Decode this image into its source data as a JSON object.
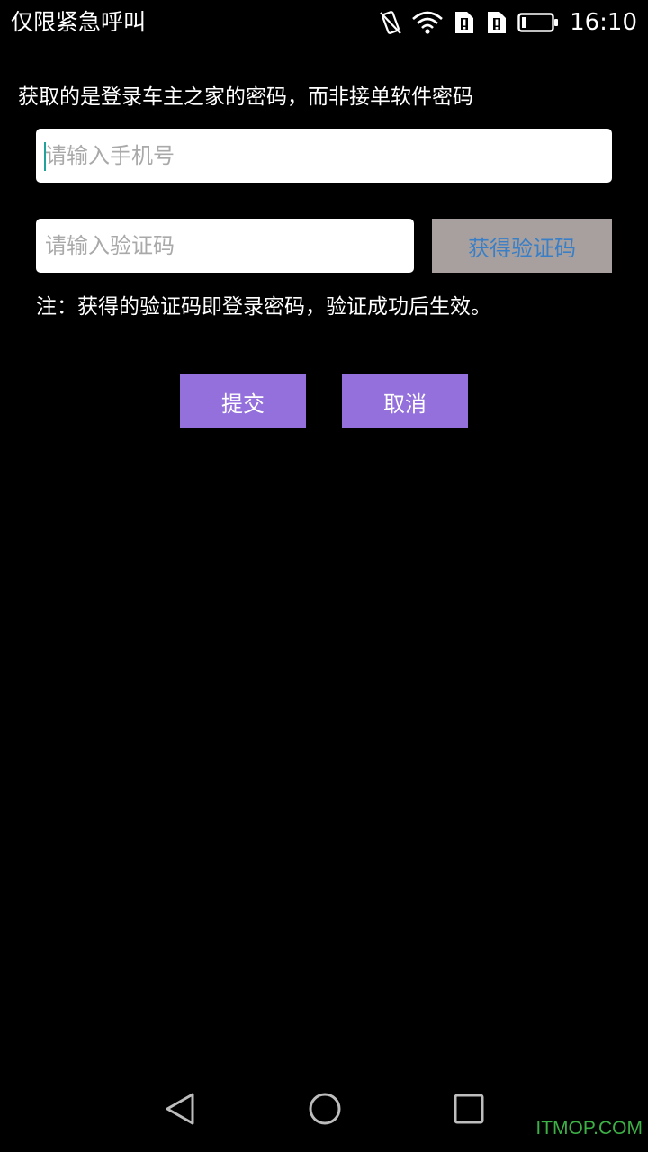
{
  "status_bar": {
    "carrier": "仅限紧急呼叫",
    "time": "16:10",
    "icons": [
      "vibrate-icon",
      "wifi-icon",
      "sim-alert-icon",
      "sim-alert-icon",
      "battery-icon"
    ]
  },
  "form": {
    "hint": "获取的是登录车主之家的密码，而非接单软件密码",
    "phone_placeholder": "请输入手机号",
    "phone_value": "",
    "code_placeholder": "请输入验证码",
    "code_value": "",
    "get_code_label": "获得验证码",
    "note": "注：获得的验证码即登录密码，验证成功后生效。"
  },
  "actions": {
    "submit_label": "提交",
    "cancel_label": "取消"
  },
  "nav_bar": {
    "buttons": [
      "back-icon",
      "home-icon",
      "recent-apps-icon"
    ]
  },
  "watermark": "ITMOP.COM",
  "colors": {
    "background": "#000000",
    "action_button": "#9370db",
    "get_code_button_bg": "#a8a09e",
    "get_code_button_text": "#3a7fc6",
    "watermark": "#3db046"
  }
}
